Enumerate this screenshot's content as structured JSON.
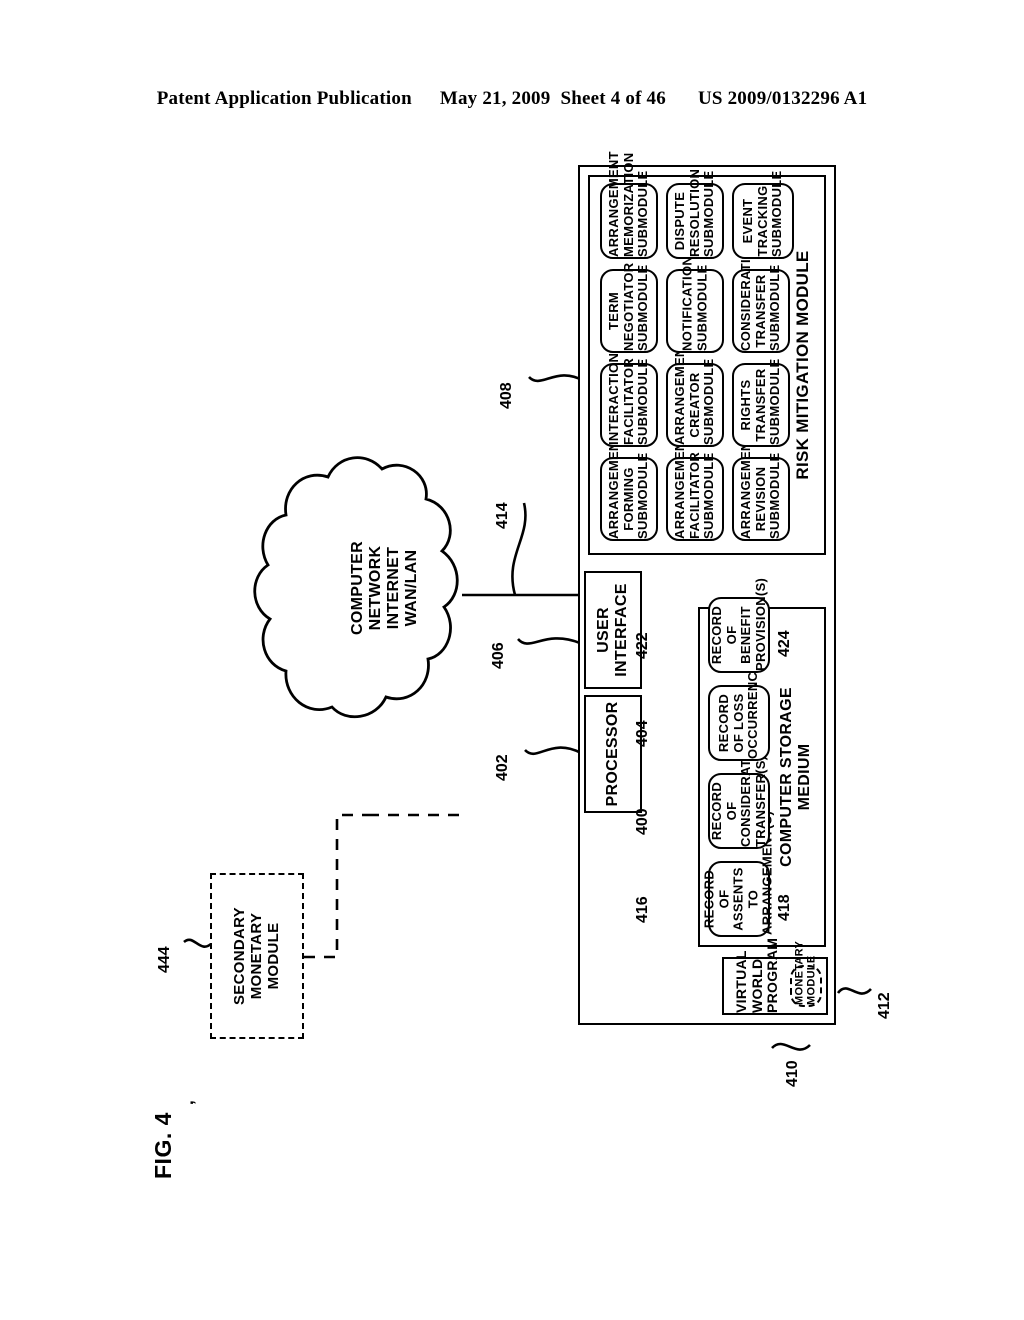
{
  "header": {
    "publication": "Patent Application Publication",
    "date": "May 21, 2009",
    "sheet": "Sheet 4 of 46",
    "docnum": "US 2009/0132296 A1"
  },
  "figure": {
    "title": "FIG. 4",
    "tick": ","
  },
  "cloud": {
    "label": "COMPUTER\nNETWORK\nINTERNET\nWAN/LAN",
    "line1": "COMPUTER",
    "line2": "NETWORK",
    "line3": "INTERNET",
    "line4": "WAN/LAN",
    "ref_left": "406",
    "ref_right": "414"
  },
  "secondary_module": {
    "line1": "SECONDARY",
    "line2": "MONETARY",
    "line3": "MODULE",
    "ref": "444"
  },
  "processor": {
    "label": "PROCESSOR",
    "ref": "402"
  },
  "user_interface": {
    "line1": "USER",
    "line2": "INTERFACE",
    "ref": "406"
  },
  "system": {
    "ref": "410"
  },
  "virtual_world": {
    "line1": "VIRTUAL",
    "line2": "WORLD",
    "line3": "PROGRAM",
    "monetary_line1": "MONETARY",
    "monetary_line2": "MODULE",
    "monetary_ref": "412"
  },
  "storage": {
    "line1": "COMPUTER STORAGE",
    "line2": "MEDIUM",
    "ref_a": "418",
    "ref_b": "424",
    "records": [
      {
        "lines": [
          "RECORD OF",
          "ASSENTS TO",
          "ARRANGEMENT(S)"
        ],
        "ref": "416"
      },
      {
        "lines": [
          "RECORD OF",
          "CONSIDERATION",
          "TRANSFER(S)"
        ],
        "ref": "400"
      },
      {
        "lines": [
          "RECORD OF LOSS",
          "OCCURRENCE(S)"
        ],
        "ref": "404"
      },
      {
        "lines": [
          "RECORD OF",
          "BENEFIT",
          "PROVISION(S)"
        ],
        "ref": "422"
      }
    ],
    "left_refs": [
      "416",
      "400",
      "404",
      "422"
    ]
  },
  "risk_module": {
    "label": "RISK MITIGATION MODULE",
    "ref": "408",
    "submodules": [
      {
        "lines": [
          "ARRANGEMENT",
          "FORMING",
          "SUBMODULE"
        ]
      },
      {
        "lines": [
          "ARRANGEMENT",
          "FACILITATOR",
          "SUBMODULE"
        ]
      },
      {
        "lines": [
          "ARRANGEMENT",
          "REVISION",
          "SUBMODULE"
        ]
      },
      {
        "lines": [
          "INTERACTION",
          "FACILITATOR",
          "SUBMODULE"
        ]
      },
      {
        "lines": [
          "ARRANGEMENT",
          "CREATOR",
          "SUBMODULE"
        ]
      },
      {
        "lines": [
          "RIGHTS",
          "TRANSFER",
          "SUBMODULE"
        ]
      },
      {
        "lines": [
          "TERM",
          "NEGOTIATOR",
          "SUBMODULE"
        ]
      },
      {
        "lines": [
          "NOTIFICATION",
          "SUBMODULE"
        ]
      },
      {
        "lines": [
          "CONSIDERATION",
          "TRANSFER",
          "SUBMODULE"
        ]
      },
      {
        "lines": [
          "ARRANGEMENT",
          "MEMORIZATION",
          "SUBMODULE"
        ]
      },
      {
        "lines": [
          "DISPUTE",
          "RESOLUTION",
          "SUBMODULE"
        ]
      },
      {
        "lines": [
          "EVENT",
          "TRACKING",
          "SUBMODULE"
        ]
      }
    ]
  }
}
